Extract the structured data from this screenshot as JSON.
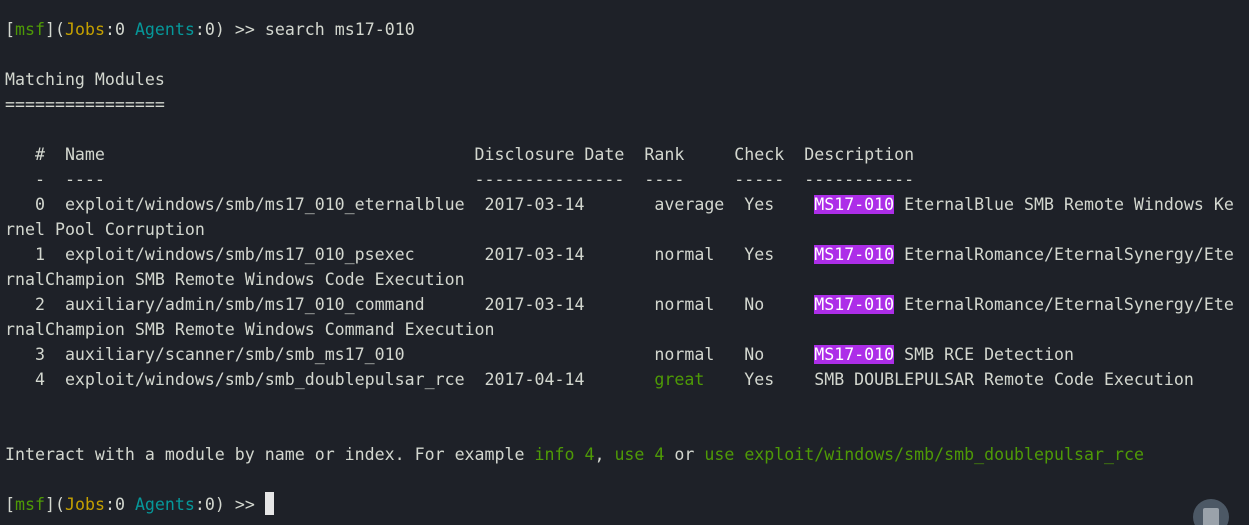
{
  "prompt": {
    "open1": "[",
    "msf": "msf",
    "close1": "](",
    "jobs_label": "Jobs",
    "jobs_sep": ":",
    "jobs_val": "0",
    "space": " ",
    "agents_label": "Agents",
    "agents_sep": ":",
    "agents_val": "0",
    "tail": ") >> "
  },
  "command": "search ms17-010",
  "heading": "Matching Modules",
  "underline": "================",
  "table": {
    "header": "   #  Name                                     Disclosure Date  Rank     Check  Description",
    "divider": "   -  ----                                     ---------------  ----     -----  -----------",
    "highlight_term": "MS17-010",
    "rows": [
      {
        "prefix": "   0  exploit/windows/smb/ms17_010_eternalblue  2017-03-14       average  Yes    ",
        "desc_after": " EternalBlue SMB Remote Windows Ke",
        "wrap": "rnel Pool Corruption"
      },
      {
        "prefix": "   1  exploit/windows/smb/ms17_010_psexec       2017-03-14       normal   Yes    ",
        "desc_after": " EternalRomance/EternalSynergy/Ete",
        "wrap": "rnalChampion SMB Remote Windows Code Execution"
      },
      {
        "prefix": "   2  auxiliary/admin/smb/ms17_010_command      2017-03-14       normal   No     ",
        "desc_after": " EternalRomance/EternalSynergy/Ete",
        "wrap": "rnalChampion SMB Remote Windows Command Execution"
      },
      {
        "prefix": "   3  auxiliary/scanner/smb/smb_ms17_010                         normal   No     ",
        "desc_after": " SMB RCE Detection"
      },
      {
        "prefix_a": "   4  exploit/windows/smb/smb_doublepulsar_rce  2017-04-14       ",
        "rank": "great",
        "prefix_b": "    Yes    SMB DOUBLEPULSAR Remote Code Execution"
      }
    ]
  },
  "hint": {
    "part1": "Interact with a module by name or index. For example ",
    "ex1": "info 4",
    "sep1": ", ",
    "ex2": "use 4",
    "sep2": " or ",
    "ex3": "use exploit/windows/smb/smb_doublepulsar_rce"
  }
}
